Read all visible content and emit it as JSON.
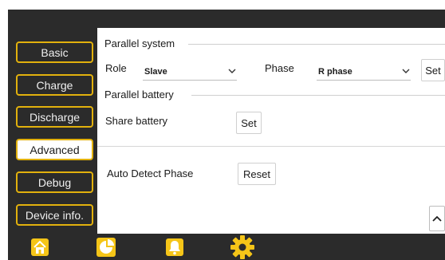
{
  "sidebar": {
    "items": [
      {
        "label": "Basic",
        "active": false
      },
      {
        "label": "Charge",
        "active": false
      },
      {
        "label": "Discharge",
        "active": false
      },
      {
        "label": "Advanced",
        "active": true
      },
      {
        "label": "Debug",
        "active": false
      },
      {
        "label": "Device info.",
        "active": false
      }
    ]
  },
  "parallel_system": {
    "title": "Parallel system",
    "role_label": "Role",
    "role_value": "Slave",
    "phase_label": "Phase",
    "phase_value": "R phase",
    "set_label": "Set"
  },
  "parallel_battery": {
    "title": "Parallel battery",
    "share_label": "Share battery",
    "set_label": "Set"
  },
  "auto_detect": {
    "label": "Auto Detect Phase",
    "reset_label": "Reset"
  },
  "bottom_nav": {
    "icons": [
      "home-icon",
      "pie-chart-icon",
      "bell-icon",
      "gear-icon"
    ]
  },
  "colors": {
    "accent": "#e2b10d",
    "icon_yellow": "#f5c518",
    "dark_bg": "#2b2b2b"
  }
}
